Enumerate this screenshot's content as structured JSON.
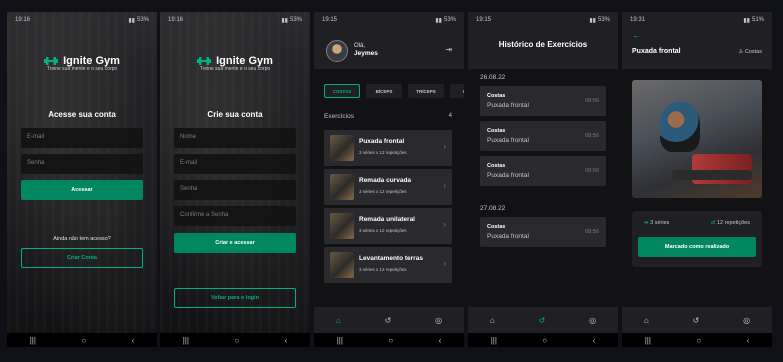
{
  "screens": {
    "signin": {
      "time": "19:16",
      "battery": "53%",
      "app_name": "Ignite Gym",
      "tagline": "Treine sua mente e o seu corpo",
      "heading": "Acesse sua conta",
      "email_placeholder": "E-mail",
      "password_placeholder": "Senha",
      "submit_label": "Acessar",
      "no_account_text": "Ainda não tem acesso?",
      "create_account_label": "Criar Conta"
    },
    "signup": {
      "time": "19:16",
      "battery": "53%",
      "app_name": "Ignite Gym",
      "tagline": "Treine sua mente e o seu corpo",
      "heading": "Crie sua conta",
      "name_placeholder": "Nome",
      "email_placeholder": "E-mail",
      "password_placeholder": "Senha",
      "confirm_placeholder": "Confirme a Senha",
      "submit_label": "Criar e acessar",
      "back_login_label": "Voltar para o login"
    },
    "home": {
      "time": "19:15",
      "battery": "53%",
      "greeting": "Olá,",
      "user_name": "Jeymes",
      "groups": [
        "COSTAS",
        "BÍCEPS",
        "TRÍCEPS",
        "OMB"
      ],
      "exercises_label": "Exercícios",
      "exercises_count": "4",
      "exercises": [
        {
          "name": "Puxada frontal",
          "detail": "3 séries x 12 repetições"
        },
        {
          "name": "Remada curvada",
          "detail": "3 séries x 12 repetições"
        },
        {
          "name": "Remada unilateral",
          "detail": "3 séries x 12 repetições"
        },
        {
          "name": "Levantamento terras",
          "detail": "3 séries x 12 repetições"
        }
      ]
    },
    "history": {
      "time": "19:15",
      "battery": "53%",
      "title": "Histórico de Exercícios",
      "sections": [
        {
          "date": "26.08.22",
          "items": [
            {
              "group": "Costas",
              "name": "Puxada frontal",
              "time": "08:56"
            },
            {
              "group": "Costas",
              "name": "Puxada frontal",
              "time": "08:56"
            },
            {
              "group": "Costas",
              "name": "Puxada frontal",
              "time": "08:56"
            }
          ]
        },
        {
          "date": "27.08.22",
          "items": [
            {
              "group": "Costas",
              "name": "Puxada frontal",
              "time": "08:56"
            }
          ]
        }
      ]
    },
    "detail": {
      "time": "19:31",
      "battery": "51%",
      "exercise_name": "Puxada frontal",
      "group": "Costas",
      "sets": "3 séries",
      "reps": "12 repetições",
      "mark_done_label": "Marcado como realizado"
    }
  }
}
